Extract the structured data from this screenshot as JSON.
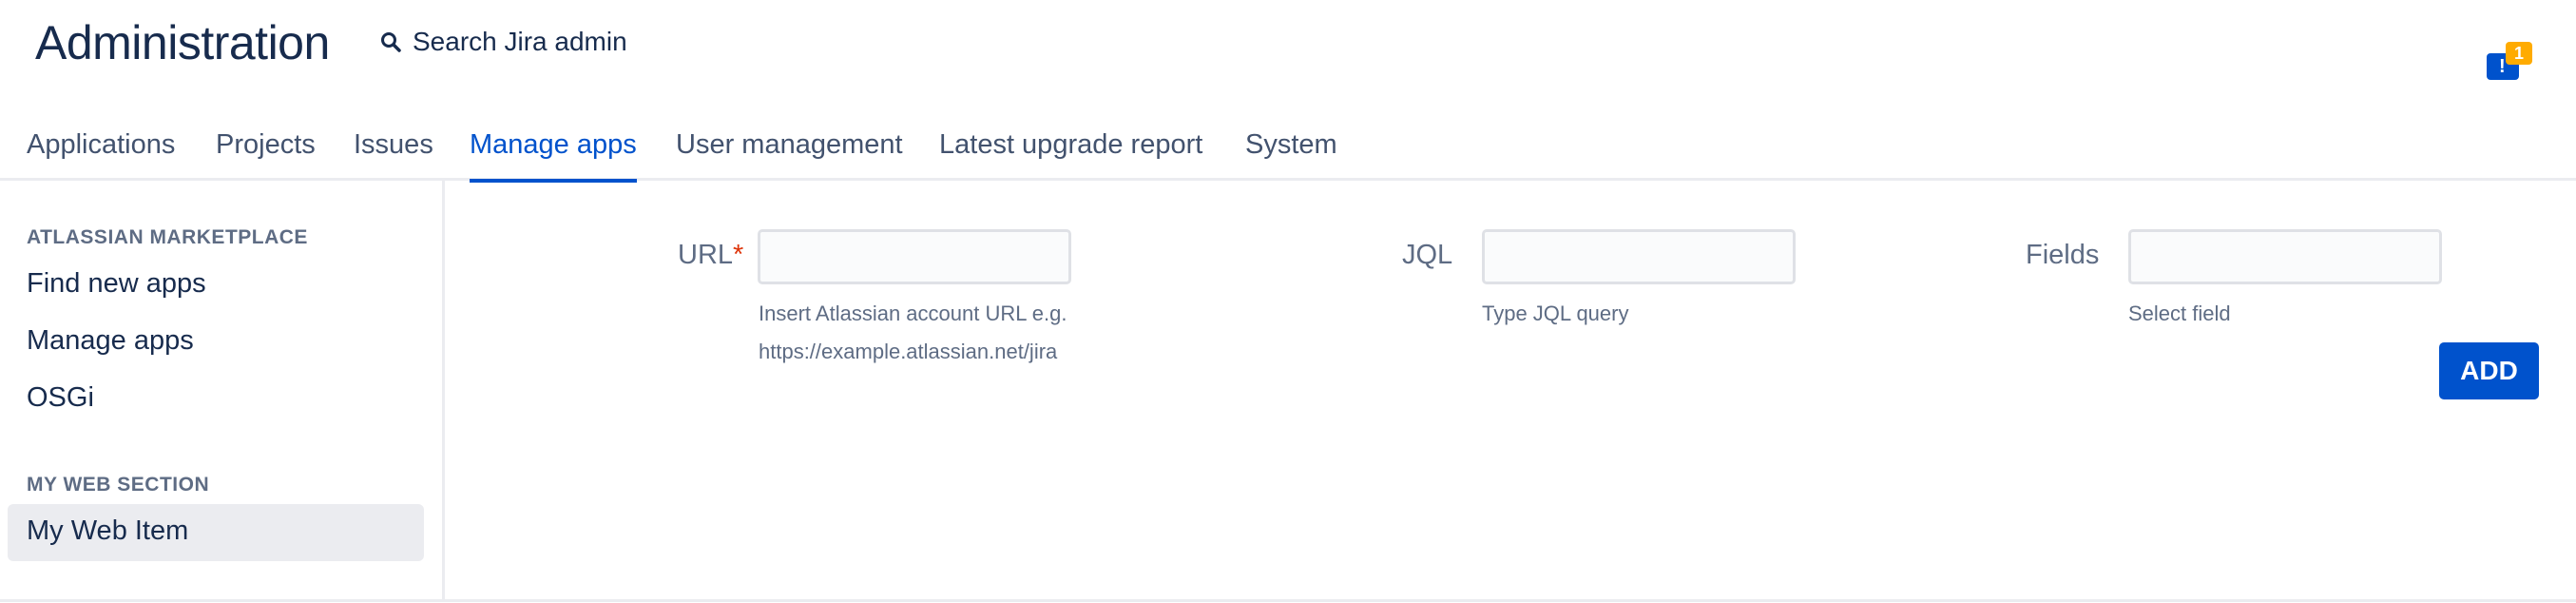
{
  "header": {
    "title": "Administration",
    "search_label": "Search Jira admin",
    "search_icon": "search-icon",
    "notification_count": "1",
    "notification_icon": "feedback-icon"
  },
  "nav": {
    "tabs": [
      {
        "label": "Applications"
      },
      {
        "label": "Projects"
      },
      {
        "label": "Issues"
      },
      {
        "label": "Manage apps",
        "active": true
      },
      {
        "label": "User management"
      },
      {
        "label": "Latest upgrade report"
      },
      {
        "label": "System"
      }
    ]
  },
  "sidebar": {
    "sections": [
      {
        "heading": "ATLASSIAN MARKETPLACE",
        "items": [
          {
            "label": "Find new apps"
          },
          {
            "label": "Manage apps"
          },
          {
            "label": "OSGi"
          }
        ]
      },
      {
        "heading": "MY WEB SECTION",
        "items": [
          {
            "label": "My Web Item",
            "active": true
          }
        ]
      }
    ]
  },
  "form": {
    "url": {
      "label": "URL",
      "required_mark": "*",
      "value": "",
      "help_line1": "Insert Atlassian account URL e.g.",
      "help_line2": "https://example.atlassian.net/jira"
    },
    "jql": {
      "label": "JQL",
      "value": "",
      "help": "Type JQL query"
    },
    "fields": {
      "label": "Fields",
      "value": "",
      "help": "Select field"
    },
    "add_button": "ADD"
  },
  "colors": {
    "accent": "#0052cc",
    "text": "#172b4d",
    "muted": "#5e6c84",
    "required": "#de350b",
    "badge": "#ffab00"
  }
}
